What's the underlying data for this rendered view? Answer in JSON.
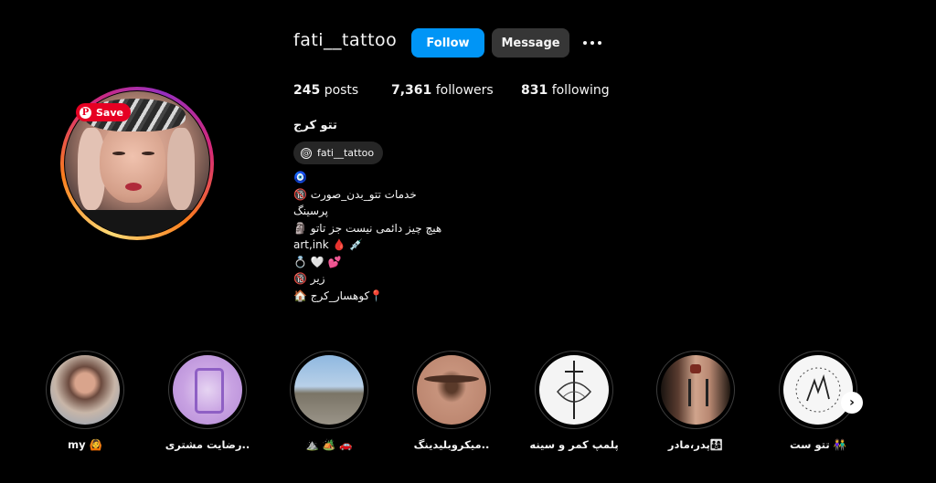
{
  "profile": {
    "username": "fati__tattoo",
    "follow_label": "Follow",
    "message_label": "Message",
    "display_name": "تتو کرج",
    "threads_handle": "fati__tattoo",
    "save_label": "Save",
    "pin_glyph": "P"
  },
  "stats": {
    "posts_count": "245",
    "posts_label": "posts",
    "followers_count": "7,361",
    "followers_label": "followers",
    "following_count": "831",
    "following_label": "following"
  },
  "bio": {
    "lines": [
      "🧿",
      "خدمات تتو_بدن_صورت 🔞",
      "پرسینگ",
      "هیچ چیز دائمی نیست جز تاتو 🗿",
      "art,ink 🩸 💉",
      "💍 🤍 💕",
      "زیر 🔞",
      "📍کوهسار_کرج 🏠"
    ]
  },
  "highlights": [
    {
      "label": "my 🙆"
    },
    {
      "label": "رضایت مشتری.."
    },
    {
      "label": "⛰️ 🏕️ 🚗"
    },
    {
      "label": "میکروبلیدینگ.."
    },
    {
      "label": "پلمپ کمر و سینه"
    },
    {
      "label": "پدر،مادر👨‍👩‍👦"
    },
    {
      "label": "تتو ست 👫"
    }
  ],
  "icons": {
    "more": "more-options-icon",
    "next": "chevron-right-icon",
    "next_glyph": "›",
    "threads": "threads-icon",
    "threads_glyph": "@"
  },
  "colors": {
    "background": "#000000",
    "follow_button": "#0095f6",
    "message_button": "#363636",
    "save_pill": "#e60023"
  }
}
